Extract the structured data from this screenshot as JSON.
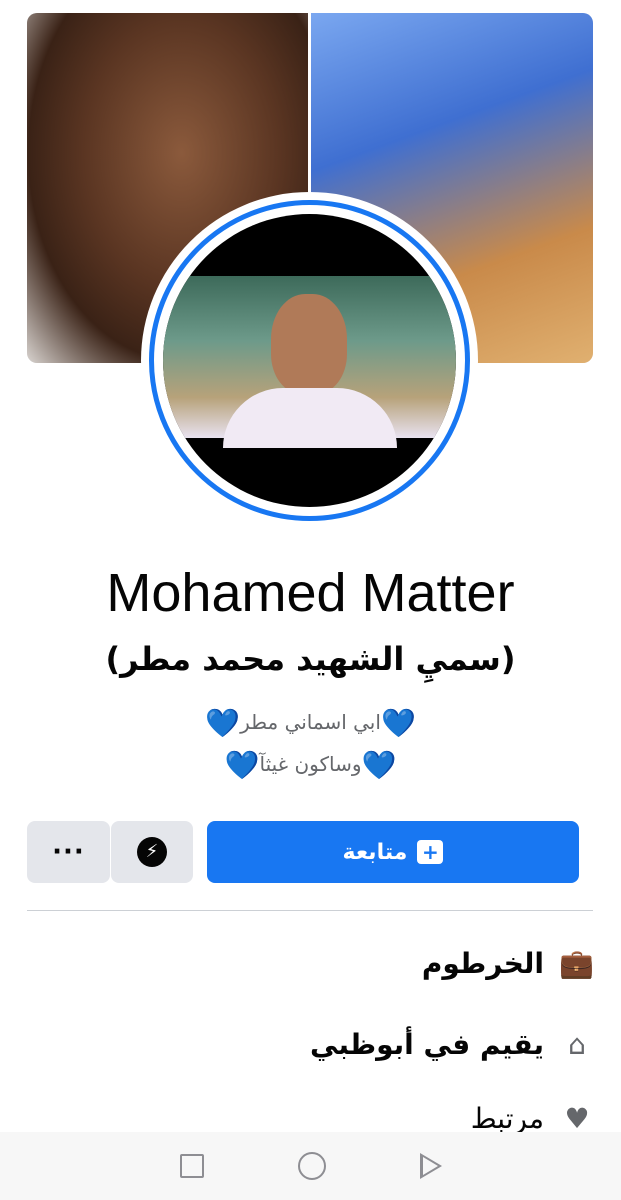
{
  "profile": {
    "name": "Mohamed Matter",
    "alt_name": "(سميِ الشهيد محمد مطر)",
    "bio_line_1": "ابي اسماني مطر",
    "bio_line_2": "وساكون غيثآ",
    "bio_emoji": "💙"
  },
  "actions": {
    "follow_label": "متابعة",
    "follow_icon": "+",
    "more_label": "···",
    "messenger_icon": "messenger-icon"
  },
  "details": {
    "work": "الخرطوم",
    "home": "يقيم في أبوظبي",
    "relationship": "مرتبط"
  },
  "colors": {
    "accent": "#1877f2",
    "button_gray": "#e4e6eb",
    "heart": "#5fb8f5"
  }
}
